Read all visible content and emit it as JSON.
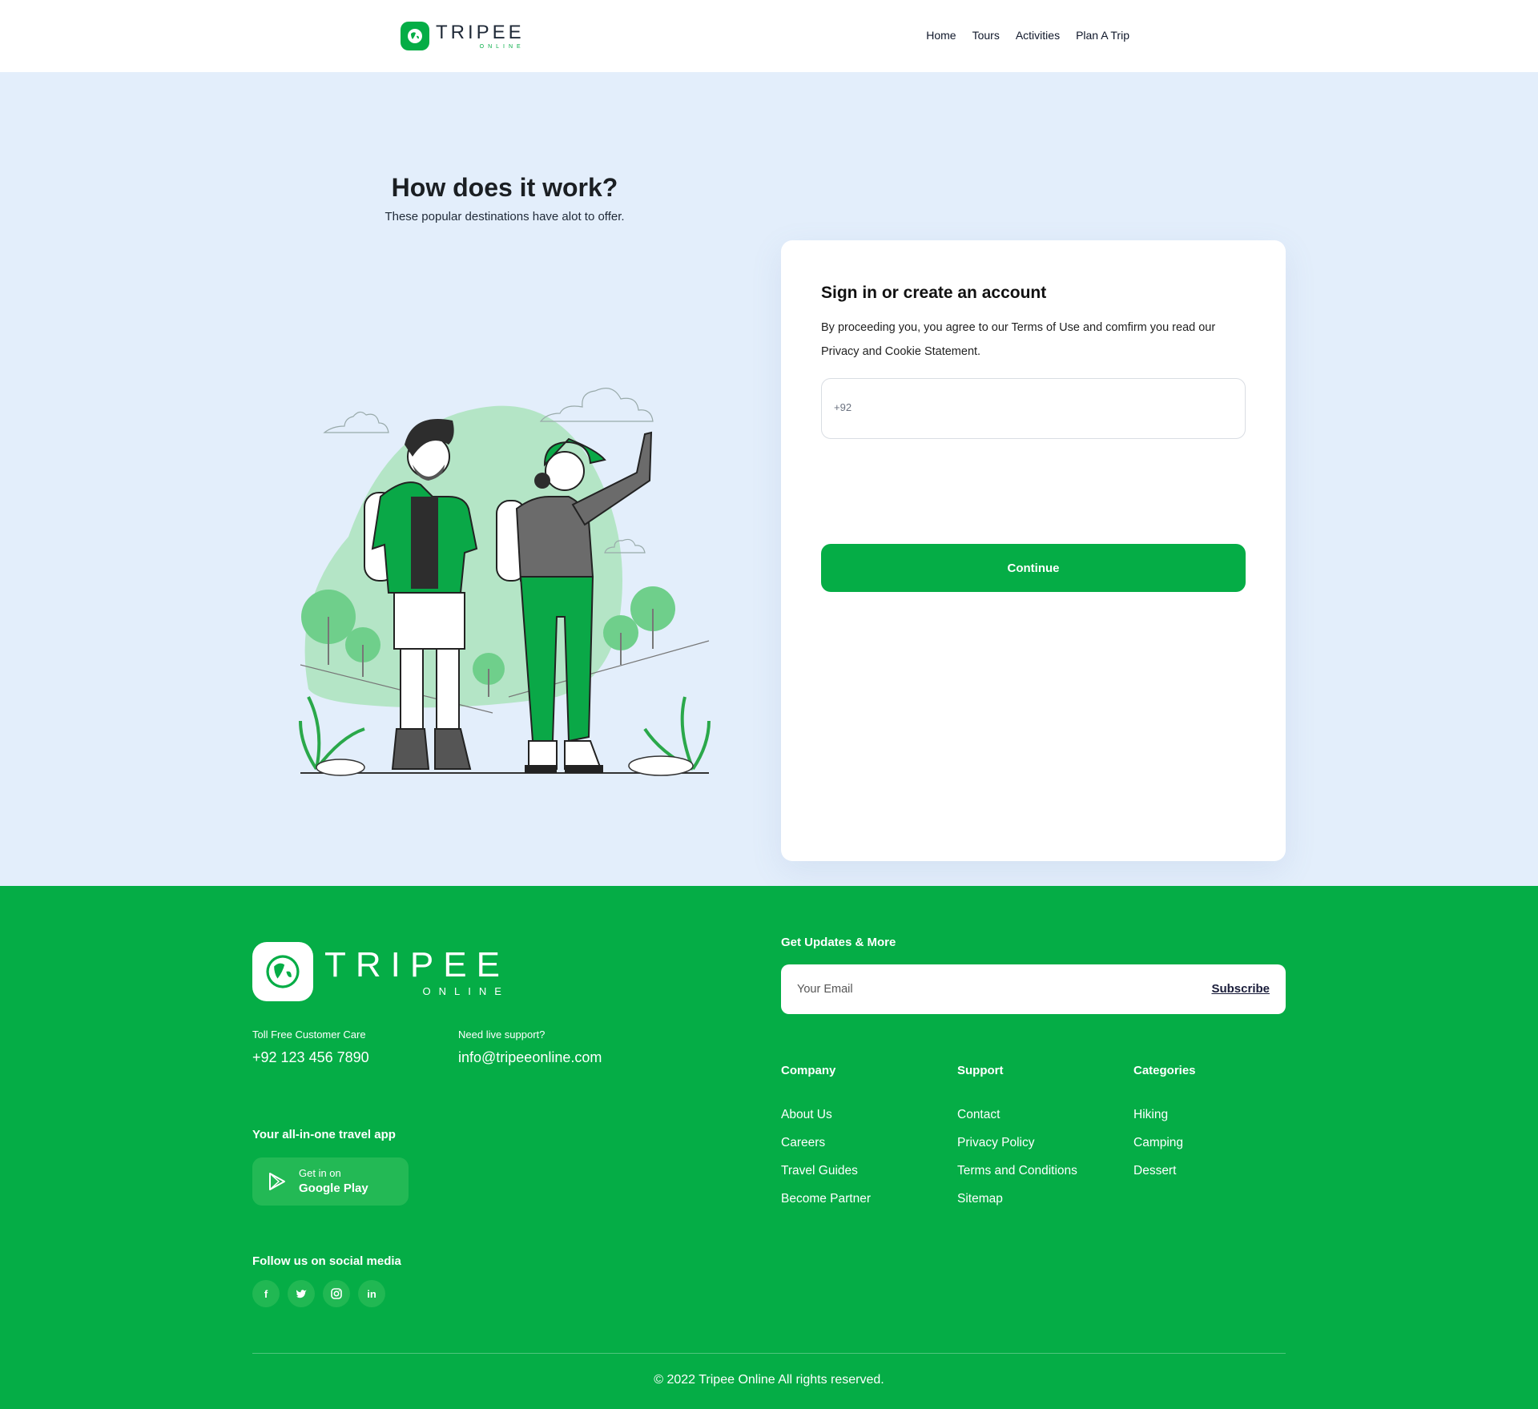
{
  "header": {
    "logo_main": "TRIPEE",
    "logo_sub": "ONLINE",
    "nav": [
      "Home",
      "Tours",
      "Activities",
      "Plan A Trip"
    ]
  },
  "hero": {
    "title": "How does it work?",
    "subtitle": "These popular destinations have alot to offer."
  },
  "signin": {
    "title": "Sign in or create an account",
    "text": "By proceeding you, you agree to our Terms of Use and comfirm you read our Privacy and Cookie Statement.",
    "phone_placeholder": "+92",
    "continue_label": "Continue"
  },
  "footer": {
    "logo_main": "TRIPEE",
    "logo_sub": "ONLINE",
    "care_label": "Toll Free Customer Care",
    "care_value": "+92 123 456 7890",
    "support_label": "Need live support?",
    "support_value": "info@tripeeonline.com",
    "app_heading": "Your all-in-one travel app",
    "gp_line1": "Get in on",
    "gp_line2": "Google Play",
    "social_heading": "Follow us on social media",
    "socials": [
      "f",
      "t",
      "ig",
      "in"
    ],
    "updates_heading": "Get Updates & More",
    "email_placeholder": "Your Email",
    "subscribe_label": "Subscribe",
    "columns": [
      {
        "title": "Company",
        "links": [
          "About Us",
          "Careers",
          "Travel Guides",
          "Become Partner"
        ]
      },
      {
        "title": "Support",
        "links": [
          "Contact",
          "Privacy Policy",
          "Terms and Conditions",
          "Sitemap"
        ]
      },
      {
        "title": "Categories",
        "links": [
          "Hiking",
          "Camping",
          "Dessert"
        ]
      }
    ],
    "copyright": "© 2022 Tripee Online All rights reserved."
  },
  "colors": {
    "brand_green": "#05ad46",
    "hero_bg": "#e3eefb",
    "nav_text": "#0f172a"
  }
}
